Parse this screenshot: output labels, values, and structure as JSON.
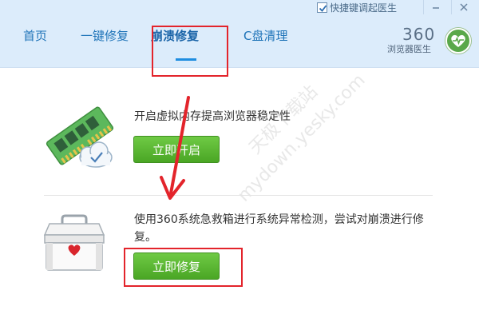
{
  "titlebar": {
    "shortcut_label": "快捷键调起医生",
    "shortcut_checked": true,
    "minimize_icon": "minimize-icon",
    "close_icon": "close-icon"
  },
  "tabs": [
    {
      "label": "首页",
      "active": false
    },
    {
      "label": "一键修复",
      "active": false
    },
    {
      "label": "崩溃修复",
      "active": true
    },
    {
      "label": "C盘清理",
      "active": false
    }
  ],
  "logo": {
    "number": "360",
    "subtitle": "浏览器医生",
    "icon": "heart-pulse-icon"
  },
  "sections": [
    {
      "description": "开启虚拟内存提高浏览器稳定性",
      "button_label": "立即开启",
      "icon": "memory-card-icon"
    },
    {
      "description": "使用360系统急救箱进行系统异常检测，尝试对崩溃进行修复。",
      "button_label": "立即修复",
      "icon": "first-aid-box-icon"
    }
  ],
  "watermark": {
    "line1": "天极下载站",
    "line2": "mydown.yesky.com"
  },
  "colors": {
    "header_bg": "#dcecfb",
    "tab_text": "#1e73b8",
    "accent_underline": "#1e8de0",
    "button_green": "#4aa625",
    "annotation_red": "#e3242b"
  }
}
